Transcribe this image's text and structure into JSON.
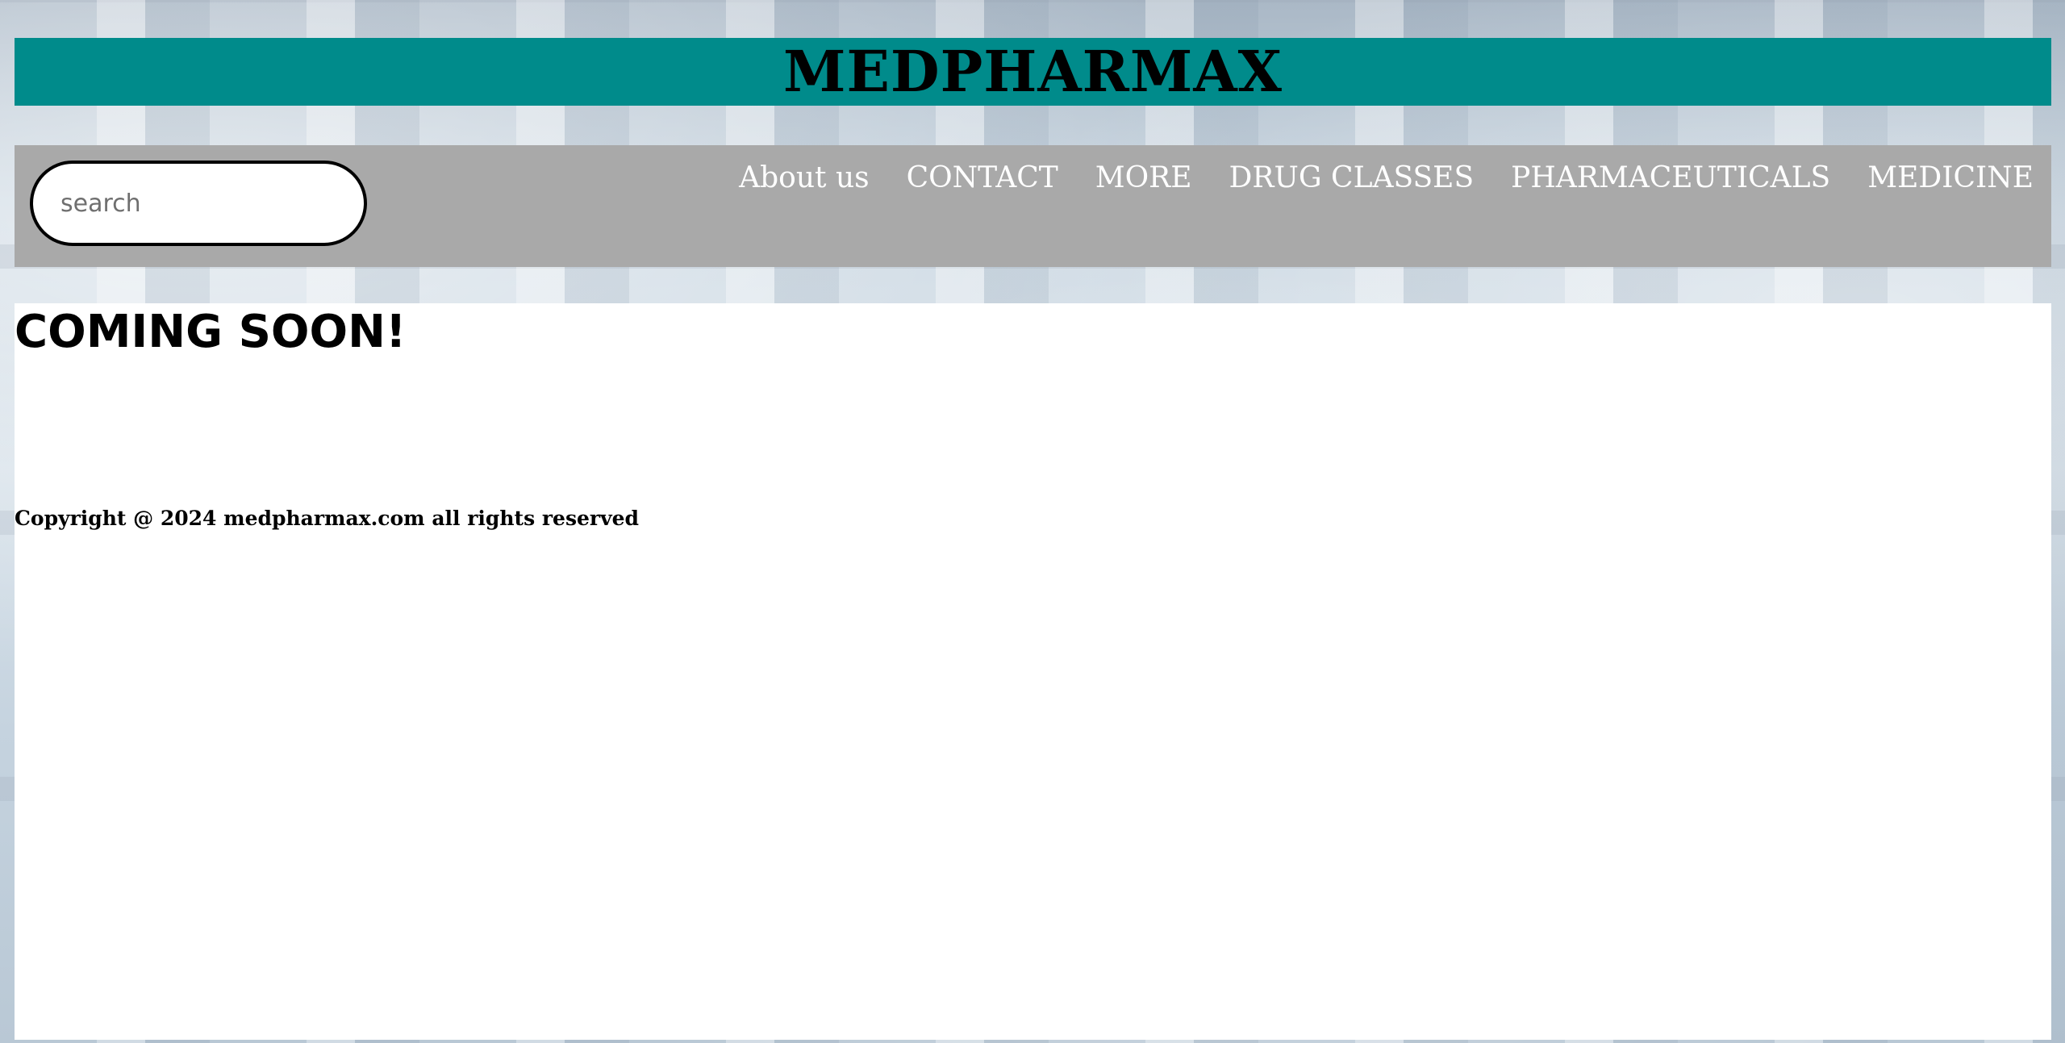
{
  "header": {
    "title": "MEDPHARMAX"
  },
  "search": {
    "placeholder": "search"
  },
  "nav": {
    "links": [
      {
        "label": "About us"
      },
      {
        "label": "CONTACT"
      },
      {
        "label": "MORE"
      },
      {
        "label": "DRUG CLASSES"
      },
      {
        "label": "PHARMACEUTICALS"
      },
      {
        "label": "MEDICINE"
      }
    ]
  },
  "main": {
    "heading": "COMING SOON!"
  },
  "footer": {
    "copyright": "Copyright @ 2024 medpharmax.com all rights reserved"
  },
  "colors": {
    "header_bg": "#008b8b",
    "nav_bg": "#a9a9a9",
    "nav_text": "#ffffff",
    "content_bg": "#ffffff"
  }
}
